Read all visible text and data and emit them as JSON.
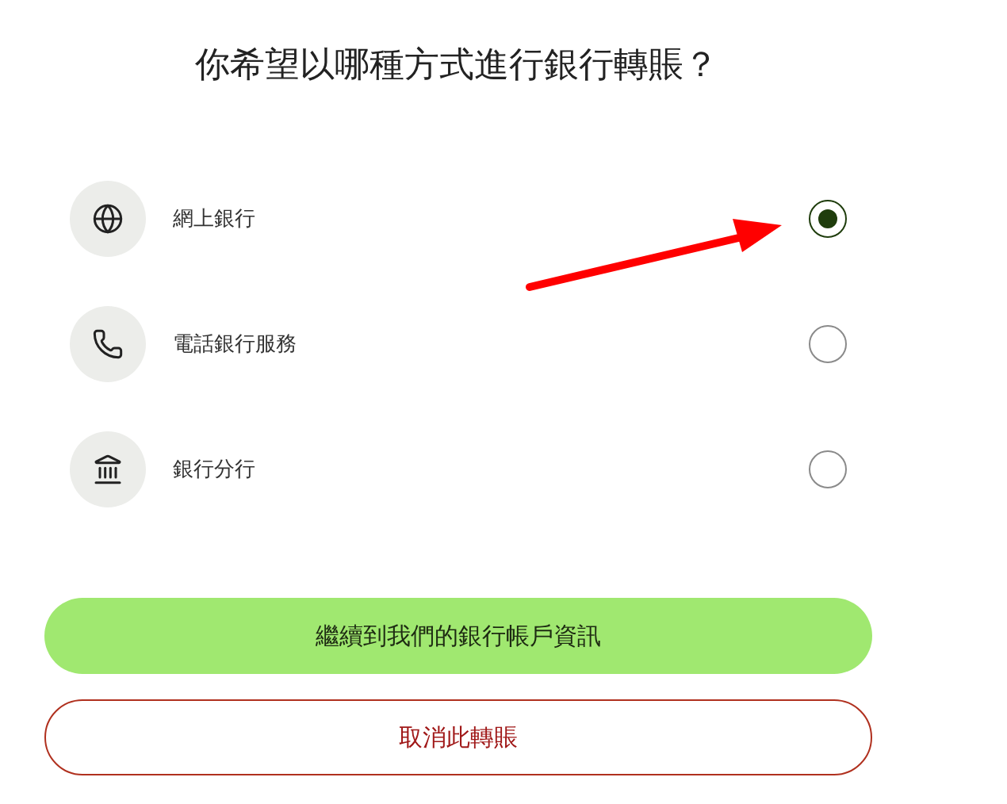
{
  "title": "你希望以哪種方式進行銀行轉賬？",
  "options": [
    {
      "kind": "online",
      "label": "網上銀行",
      "selected": true
    },
    {
      "kind": "phone",
      "label": "電話銀行服務",
      "selected": false
    },
    {
      "kind": "branch",
      "label": "銀行分行",
      "selected": false
    }
  ],
  "buttons": [
    {
      "kind": "primary",
      "label": "繼續到我們的銀行帳戶資訊"
    },
    {
      "kind": "secondary",
      "label": "取消此轉賬"
    }
  ]
}
